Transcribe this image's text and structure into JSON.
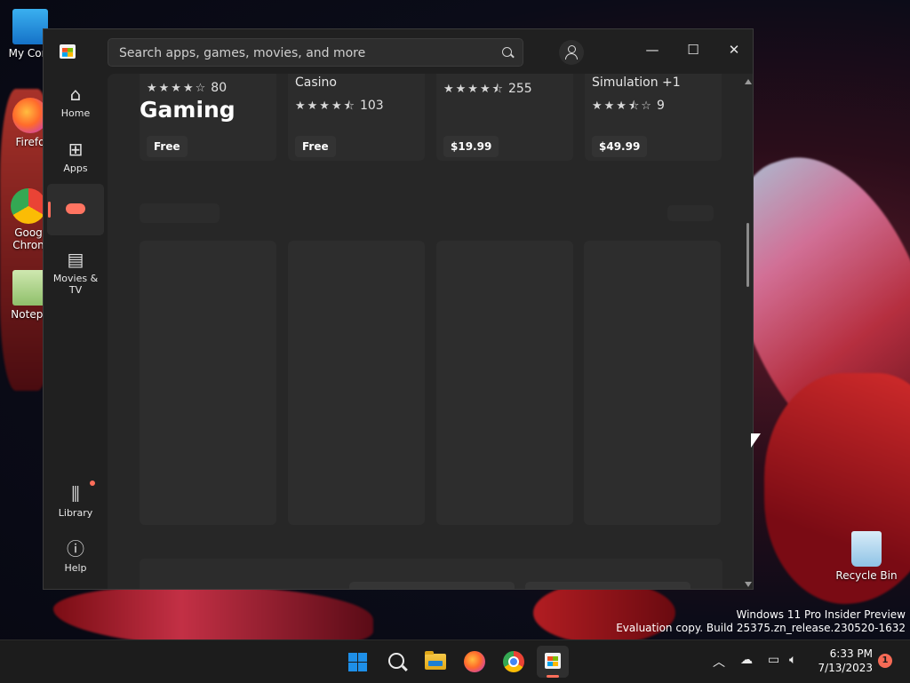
{
  "desktop": {
    "icons": [
      {
        "label": "My Com"
      },
      {
        "label": "Firefo"
      },
      {
        "label": "Goog Chron"
      },
      {
        "label": "Notepa"
      },
      {
        "label": "Recycle Bin"
      }
    ],
    "watermark_line1": "Windows 11 Pro Insider Preview",
    "watermark_line2": "Evaluation copy. Build 25375.zn_release.230520-1632"
  },
  "window": {
    "search_placeholder": "Search apps, games, movies, and more",
    "controls": {
      "minimize": "—",
      "maximize": "☐",
      "close": "✕"
    }
  },
  "sidebar": {
    "items": [
      {
        "label": "Home",
        "icon": "home-icon"
      },
      {
        "label": "Apps",
        "icon": "apps-icon"
      },
      {
        "label": "",
        "icon": "gamepad-icon",
        "active": true
      },
      {
        "label": "Movies & TV",
        "icon": "clapperboard-icon"
      },
      {
        "label": "Library",
        "icon": "library-icon",
        "badge": true
      },
      {
        "label": "Help",
        "icon": "help-icon"
      }
    ]
  },
  "content": {
    "section_heading": "Gaming",
    "cards": [
      {
        "title": "",
        "stars": "★★★★☆",
        "count": "80",
        "price": "Free"
      },
      {
        "title": "Casino",
        "stars": "★★★★⯪",
        "count": "103",
        "price": "Free"
      },
      {
        "title": "",
        "stars": "★★★★⯪",
        "count": "255",
        "price": "$19.99"
      },
      {
        "title": "Simulation +1",
        "stars": "★★★⯪☆",
        "count": "9",
        "price": "$49.99"
      }
    ]
  },
  "taskbar": {
    "apps": [
      "start-icon",
      "search-icon",
      "file-explorer-icon",
      "firefox-icon",
      "chrome-icon",
      "store-icon"
    ],
    "time": "6:33 PM",
    "date": "7/13/2023",
    "notification_count": "1"
  },
  "colors": {
    "accent": "#ff6e5a",
    "window_bg": "#202020",
    "content_bg": "#272727"
  }
}
